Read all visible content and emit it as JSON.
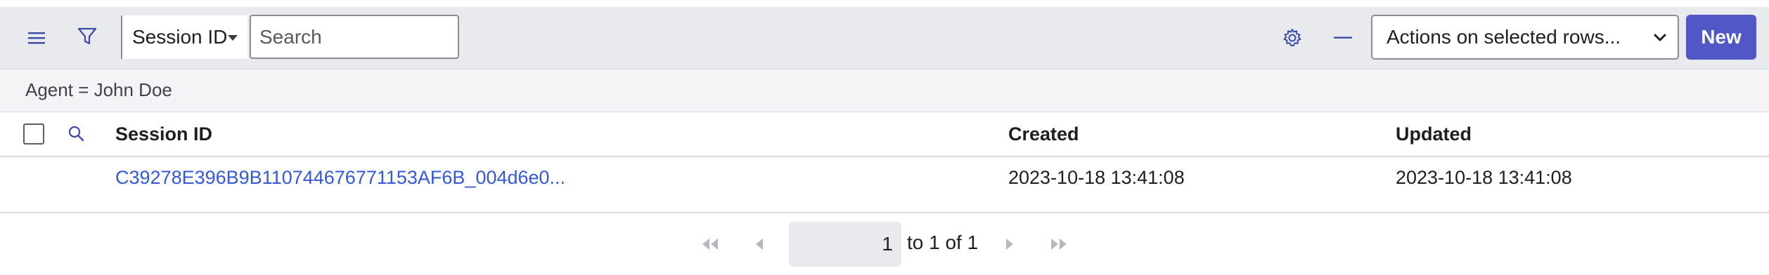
{
  "toolbar": {
    "menu_icon": "hamburger-menu-icon",
    "filter_icon": "funnel-filter-icon",
    "field_select_value": "Session ID",
    "search_placeholder": "Search",
    "settings_icon": "gear-icon",
    "collapse_icon": "minus-icon",
    "actions_select_value": "Actions on selected rows...",
    "new_label": "New",
    "accent_color": "#5157c7"
  },
  "filter": {
    "breadcrumb": "Agent = John Doe"
  },
  "table": {
    "columns": [
      "Session ID",
      "Created",
      "Updated"
    ],
    "rows": [
      {
        "session_id": "C39278E396B9B110744676771153AF6B_004d6e0...",
        "created": "2023-10-18 13:41:08",
        "updated": "2023-10-18 13:41:08"
      }
    ]
  },
  "pagination": {
    "current_page": "1",
    "range_text": "to 1 of 1"
  }
}
